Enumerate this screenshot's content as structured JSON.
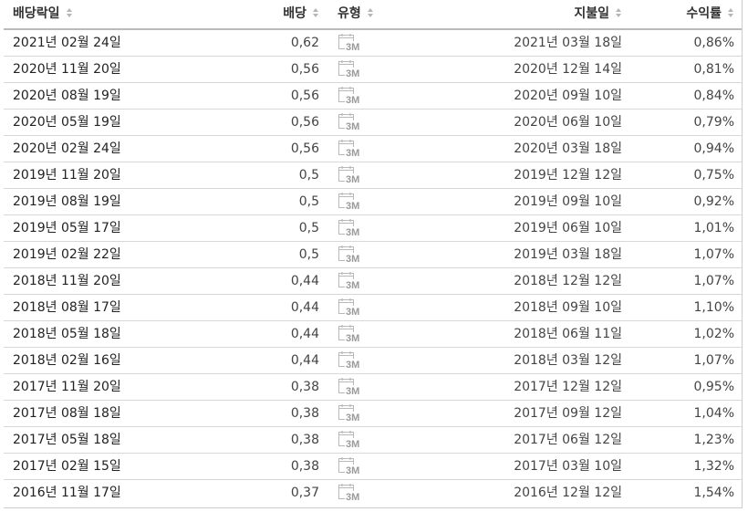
{
  "header": {
    "ex_date": "배당락일",
    "amount": "배당",
    "type": "유형",
    "pay_date": "지불일",
    "yield": "수익률"
  },
  "type_icon_name": "calendar-3m-icon",
  "type_icon_label": "3M",
  "rows": [
    {
      "ex_date": "2021년 02월 24일",
      "amount": "0,62",
      "type": "3M",
      "pay_date": "2021년 03월 18일",
      "yield": "0,86%"
    },
    {
      "ex_date": "2020년 11월 20일",
      "amount": "0,56",
      "type": "3M",
      "pay_date": "2020년 12월 14일",
      "yield": "0,81%"
    },
    {
      "ex_date": "2020년 08월 19일",
      "amount": "0,56",
      "type": "3M",
      "pay_date": "2020년 09월 10일",
      "yield": "0,84%"
    },
    {
      "ex_date": "2020년 05월 19일",
      "amount": "0,56",
      "type": "3M",
      "pay_date": "2020년 06월 10일",
      "yield": "0,79%"
    },
    {
      "ex_date": "2020년 02월 24일",
      "amount": "0,56",
      "type": "3M",
      "pay_date": "2020년 03월 18일",
      "yield": "0,94%"
    },
    {
      "ex_date": "2019년 11월 20일",
      "amount": "0,5",
      "type": "3M",
      "pay_date": "2019년 12월 12일",
      "yield": "0,75%"
    },
    {
      "ex_date": "2019년 08월 19일",
      "amount": "0,5",
      "type": "3M",
      "pay_date": "2019년 09월 10일",
      "yield": "0,92%"
    },
    {
      "ex_date": "2019년 05월 17일",
      "amount": "0,5",
      "type": "3M",
      "pay_date": "2019년 06월 10일",
      "yield": "1,01%"
    },
    {
      "ex_date": "2019년 02월 22일",
      "amount": "0,5",
      "type": "3M",
      "pay_date": "2019년 03월 18일",
      "yield": "1,07%"
    },
    {
      "ex_date": "2018년 11월 20일",
      "amount": "0,44",
      "type": "3M",
      "pay_date": "2018년 12월 12일",
      "yield": "1,07%"
    },
    {
      "ex_date": "2018년 08월 17일",
      "amount": "0,44",
      "type": "3M",
      "pay_date": "2018년 09월 10일",
      "yield": "1,10%"
    },
    {
      "ex_date": "2018년 05월 18일",
      "amount": "0,44",
      "type": "3M",
      "pay_date": "2018년 06월 11일",
      "yield": "1,02%"
    },
    {
      "ex_date": "2018년 02월 16일",
      "amount": "0,44",
      "type": "3M",
      "pay_date": "2018년 03월 12일",
      "yield": "1,07%"
    },
    {
      "ex_date": "2017년 11월 20일",
      "amount": "0,38",
      "type": "3M",
      "pay_date": "2017년 12월 12일",
      "yield": "0,95%"
    },
    {
      "ex_date": "2017년 08월 18일",
      "amount": "0,38",
      "type": "3M",
      "pay_date": "2017년 09월 12일",
      "yield": "1,04%"
    },
    {
      "ex_date": "2017년 05월 18일",
      "amount": "0,38",
      "type": "3M",
      "pay_date": "2017년 06월 12일",
      "yield": "1,23%"
    },
    {
      "ex_date": "2017년 02월 15일",
      "amount": "0,38",
      "type": "3M",
      "pay_date": "2017년 03월 10일",
      "yield": "1,32%"
    },
    {
      "ex_date": "2016년 11월 17일",
      "amount": "0,37",
      "type": "3M",
      "pay_date": "2016년 12월 12일",
      "yield": "1,54%"
    }
  ]
}
